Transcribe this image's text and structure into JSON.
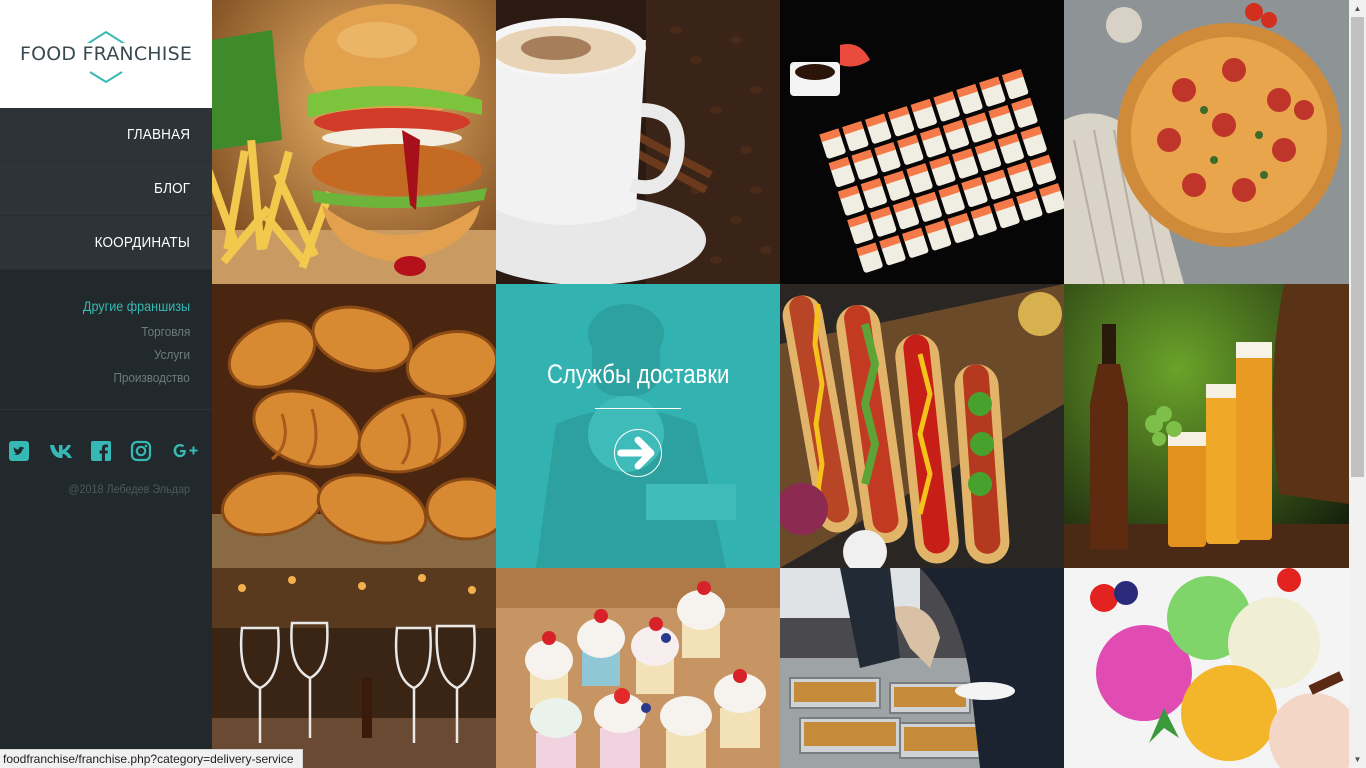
{
  "brand": {
    "name": "FOOD FRANCHISE"
  },
  "nav": [
    {
      "label": "ГЛАВНАЯ"
    },
    {
      "label": "БЛОГ"
    },
    {
      "label": "КООРДИНАТЫ"
    }
  ],
  "categories": {
    "heading": "Другие франшизы",
    "items": [
      {
        "label": "Торговля"
      },
      {
        "label": "Услуги"
      },
      {
        "label": "Производство"
      }
    ]
  },
  "social": [
    {
      "icon": "twitter-icon"
    },
    {
      "icon": "vk-icon"
    },
    {
      "icon": "facebook-icon"
    },
    {
      "icon": "instagram-icon"
    },
    {
      "icon": "google-plus-icon"
    }
  ],
  "copyright": "@2018 Лебедев Эльдар",
  "tiles": [
    {
      "image": "burger-fries-photo"
    },
    {
      "image": "coffee-cup-photo"
    },
    {
      "image": "sushi-rolls-photo"
    },
    {
      "image": "pizza-photo"
    },
    {
      "image": "croissants-photo"
    },
    {
      "title": "Службы доставки",
      "icon": "arrow-right-icon"
    },
    {
      "image": "hot-dogs-photo"
    },
    {
      "image": "beer-photo"
    },
    {
      "image": "restaurant-glasses-photo"
    },
    {
      "image": "cupcakes-photo"
    },
    {
      "image": "buffet-catering-photo"
    },
    {
      "image": "ice-cream-photo"
    }
  ],
  "status_bar": {
    "url": "foodfranchise/franchise.php?category=delivery-service"
  },
  "colors": {
    "accent": "#36b8b4",
    "sidebar": "#21292c",
    "delivery_tile": "#32b3b1"
  }
}
